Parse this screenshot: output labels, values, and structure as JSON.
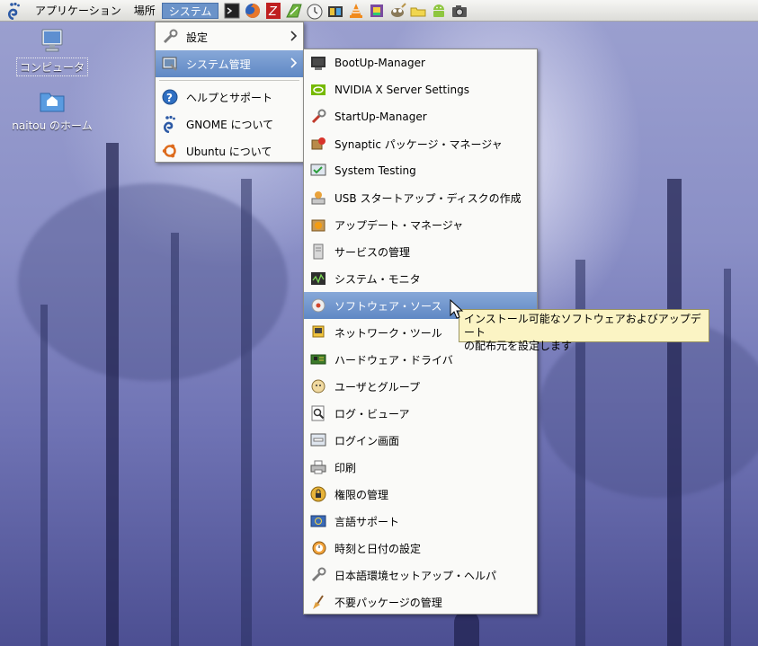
{
  "panel": {
    "menus": [
      "アプリケーション",
      "場所",
      "システム"
    ],
    "launchers": [
      "terminal-icon",
      "firefox-icon",
      "filezilla-icon",
      "inkscape-icon",
      "clock-icon",
      "video-editor-icon",
      "vlc-icon",
      "gnome-paint-icon",
      "gimp-icon",
      "folder-icon",
      "android-icon",
      "camera-icon"
    ]
  },
  "desktop": {
    "icons": [
      {
        "label": "コンピュータ",
        "icon": "computer-icon"
      },
      {
        "label": "naitou のホーム",
        "icon": "home-folder-icon"
      }
    ]
  },
  "system_menu": {
    "items": [
      {
        "label": "設定",
        "icon": "wrench-icon",
        "submenu": true
      },
      {
        "label": "システム管理",
        "icon": "admin-icon",
        "submenu": true,
        "highlighted": true
      },
      {
        "label": "ヘルプとサポート",
        "icon": "help-icon"
      },
      {
        "label": "GNOME について",
        "icon": "gnome-icon"
      },
      {
        "label": "Ubuntu について",
        "icon": "ubuntu-icon"
      }
    ]
  },
  "admin_menu": {
    "items": [
      {
        "label": "BootUp-Manager",
        "icon": "bootup-icon"
      },
      {
        "label": "NVIDIA X Server Settings",
        "icon": "nvidia-icon"
      },
      {
        "label": "StartUp-Manager",
        "icon": "startup-wrench-icon"
      },
      {
        "label": "Synaptic パッケージ・マネージャ",
        "icon": "synaptic-icon"
      },
      {
        "label": "System Testing",
        "icon": "system-testing-icon"
      },
      {
        "label": "USB スタートアップ・ディスクの作成",
        "icon": "usb-icon"
      },
      {
        "label": "アップデート・マネージャ",
        "icon": "update-manager-icon"
      },
      {
        "label": "サービスの管理",
        "icon": "services-icon"
      },
      {
        "label": "システム・モニタ",
        "icon": "system-monitor-icon"
      },
      {
        "label": "ソフトウェア・ソース",
        "icon": "software-sources-icon",
        "highlighted": true
      },
      {
        "label": "ネットワーク・ツール",
        "icon": "network-tools-icon"
      },
      {
        "label": "ハードウェア・ドライバ",
        "icon": "hardware-drivers-icon"
      },
      {
        "label": "ユーザとグループ",
        "icon": "users-groups-icon"
      },
      {
        "label": "ログ・ビューア",
        "icon": "log-viewer-icon"
      },
      {
        "label": "ログイン画面",
        "icon": "login-screen-icon"
      },
      {
        "label": "印刷",
        "icon": "printer-icon"
      },
      {
        "label": "権限の管理",
        "icon": "lock-icon"
      },
      {
        "label": "言語サポート",
        "icon": "language-flag-icon"
      },
      {
        "label": "時刻と日付の設定",
        "icon": "time-date-icon"
      },
      {
        "label": "日本語環境セットアップ・ヘルパ",
        "icon": "wrench-icon"
      },
      {
        "label": "不要パッケージの管理",
        "icon": "broom-icon"
      }
    ]
  },
  "tooltip": {
    "line1": "インストール可能なソフトウェアおよびアップデート",
    "line2": "の配布元を設定します"
  }
}
